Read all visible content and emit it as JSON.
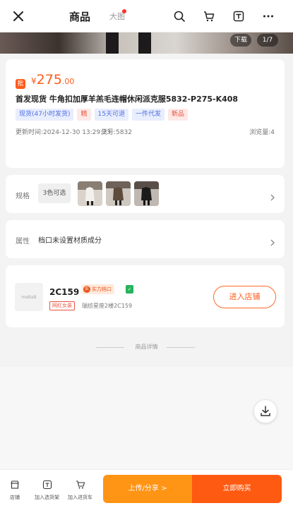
{
  "header": {
    "tab_goods": "商品",
    "tab_image": "大图"
  },
  "image_strip": {
    "download_label": "下载",
    "page_indicator": "1/7"
  },
  "product": {
    "price_symbol": "¥",
    "price_integer": "275",
    "price_decimal": ".00",
    "title": "首发现货 牛角扣加厚羊羔毛连帽休闲派克服5832-P275-K408",
    "tags": [
      {
        "text": "现货(47小时发货)",
        "style": "blue"
      },
      {
        "text": "精",
        "style": "red"
      },
      {
        "text": "15天可退",
        "style": "blue"
      },
      {
        "text": "一件代发",
        "style": "blue"
      },
      {
        "text": "新品",
        "style": "red"
      }
    ],
    "updated_time": "更新时间:2024-12-30 13:29:23",
    "item_number": "货号:5832",
    "views": "浏览量:4"
  },
  "spec": {
    "label": "规格",
    "colors_available": "3色可选"
  },
  "attributes": {
    "label": "属性",
    "value": "档口未设置材质成分"
  },
  "shop": {
    "logo_text": "meBaB",
    "name": "2C159",
    "tag": "网红女装",
    "strength_label": "实力档口",
    "address": "瑞纺星座2楼2C159",
    "enter_button": "进入店铺"
  },
  "details_divider": "商品详情",
  "bottom_bar": {
    "shop_label": "店铺",
    "add_shelf_label": "加入选货架",
    "add_cart_label": "加入进货车",
    "upload_share_label": "上传/分享 >",
    "buy_now_label": "立即购买"
  },
  "colors": {
    "accent_orange": "#ff5b1a",
    "upload_orange": "#ff9415",
    "buy_orange": "#ff5a11"
  }
}
